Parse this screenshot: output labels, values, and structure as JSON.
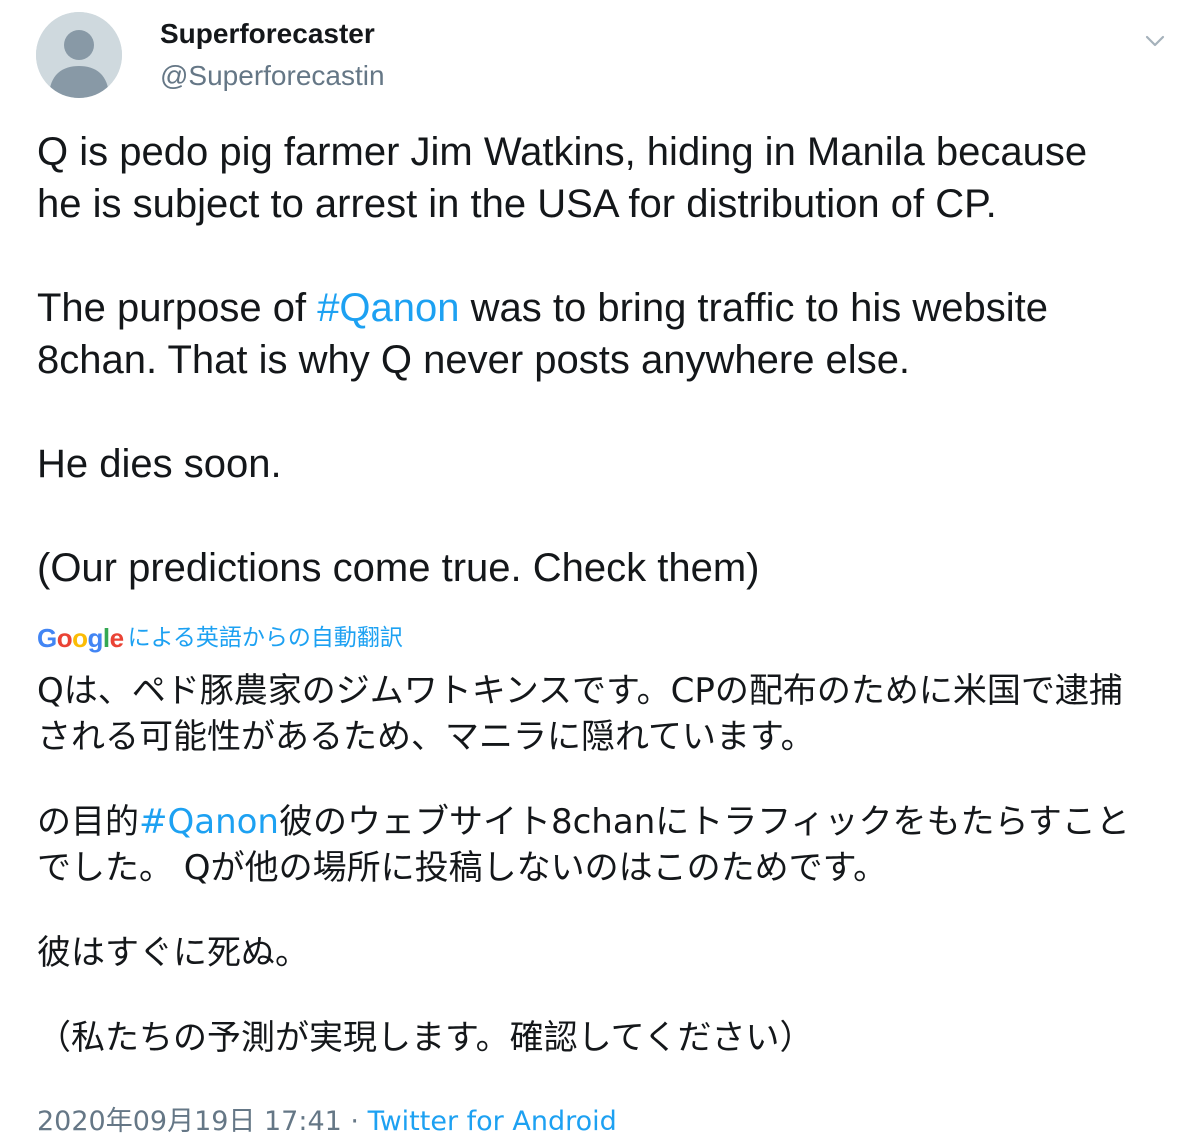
{
  "author": {
    "display_name": "Superforecaster",
    "handle": "@Superforecastin",
    "avatar_icon": "default-avatar-icon"
  },
  "menu": {
    "icon": "chevron-down-icon"
  },
  "tweet": {
    "paragraphs": [
      {
        "segments": [
          {
            "text": "Q is pedo pig farmer Jim Watkins, hiding in Manila because\nhe is subject to arrest in the USA for distribution of CP.",
            "type": "text"
          }
        ]
      },
      {
        "segments": [
          {
            "text": "The purpose of ",
            "type": "text"
          },
          {
            "text": "#Qanon",
            "type": "hashtag"
          },
          {
            "text": " was to bring traffic to his website\n8chan. That is why Q never posts anywhere else.",
            "type": "text"
          }
        ]
      },
      {
        "segments": [
          {
            "text": "He dies soon.",
            "type": "text"
          }
        ]
      },
      {
        "segments": [
          {
            "text": "(Our predictions come true. Check them)",
            "type": "text"
          }
        ]
      }
    ]
  },
  "translation": {
    "google_logo_letters": [
      {
        "ch": "G",
        "color": "#4285f4"
      },
      {
        "ch": "o",
        "color": "#ea4335"
      },
      {
        "ch": "o",
        "color": "#fbbc05"
      },
      {
        "ch": "g",
        "color": "#4285f4"
      },
      {
        "ch": "l",
        "color": "#34a853"
      },
      {
        "ch": "e",
        "color": "#ea4335"
      }
    ],
    "label": "による英語からの自動翻訳",
    "paragraphs": [
      {
        "segments": [
          {
            "text": "Qは、ペド豚農家のジムワトキンスです。CPの配布のために米国で逮捕\nされる可能性があるため、マニラに隠れています。",
            "type": "text"
          }
        ]
      },
      {
        "segments": [
          {
            "text": "の目的",
            "type": "text"
          },
          {
            "text": "#Qanon",
            "type": "hashtag"
          },
          {
            "text": "彼のウェブサイト8chanにトラフィックをもたらすこと\nでした。 Qが他の場所に投稿しないのはこのためです。",
            "type": "text"
          }
        ]
      },
      {
        "segments": [
          {
            "text": "彼はすぐに死ぬ。",
            "type": "text"
          }
        ]
      },
      {
        "segments": [
          {
            "text": "（私たちの予測が実現します。確認してください）",
            "type": "text"
          }
        ]
      }
    ]
  },
  "meta": {
    "timestamp": "2020年09月19日 17:41",
    "separator": " · ",
    "source": "Twitter for Android"
  },
  "colors": {
    "link": "#1da1f2",
    "text": "#14171a",
    "secondary": "#657786",
    "avatar_bg": "#cfd9de",
    "avatar_fg": "#8899a6"
  }
}
